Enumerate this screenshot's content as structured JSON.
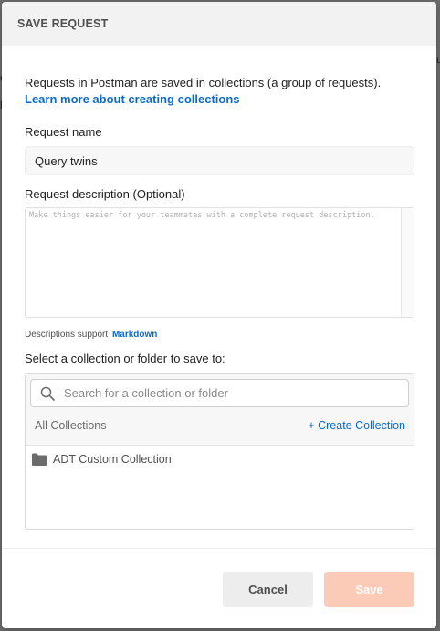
{
  "backdrop": {
    "char_right": "u",
    "char_left_1": "e",
    "char_left_2": "l"
  },
  "modal": {
    "title": "SAVE REQUEST"
  },
  "intro": {
    "text": "Requests in Postman are saved in collections (a group of requests).",
    "link": "Learn more about creating collections"
  },
  "request_name": {
    "label": "Request name",
    "value": "Query twins"
  },
  "request_description": {
    "label": "Request description (Optional)",
    "placeholder": "Make things easier for your teammates with a complete request description."
  },
  "markdown_note": {
    "text": "Descriptions support",
    "link": "Markdown"
  },
  "collection": {
    "label": "Select a collection or folder to save to:",
    "search_placeholder": "Search for a collection or folder",
    "all_label": "All Collections",
    "create_label": "+ Create Collection",
    "items": [
      {
        "label": "ADT Custom Collection"
      }
    ]
  },
  "footer": {
    "cancel_label": "Cancel",
    "save_label": "Save"
  },
  "colors": {
    "accent": "#0b6bcb",
    "save_disabled": "#fccbb8"
  }
}
